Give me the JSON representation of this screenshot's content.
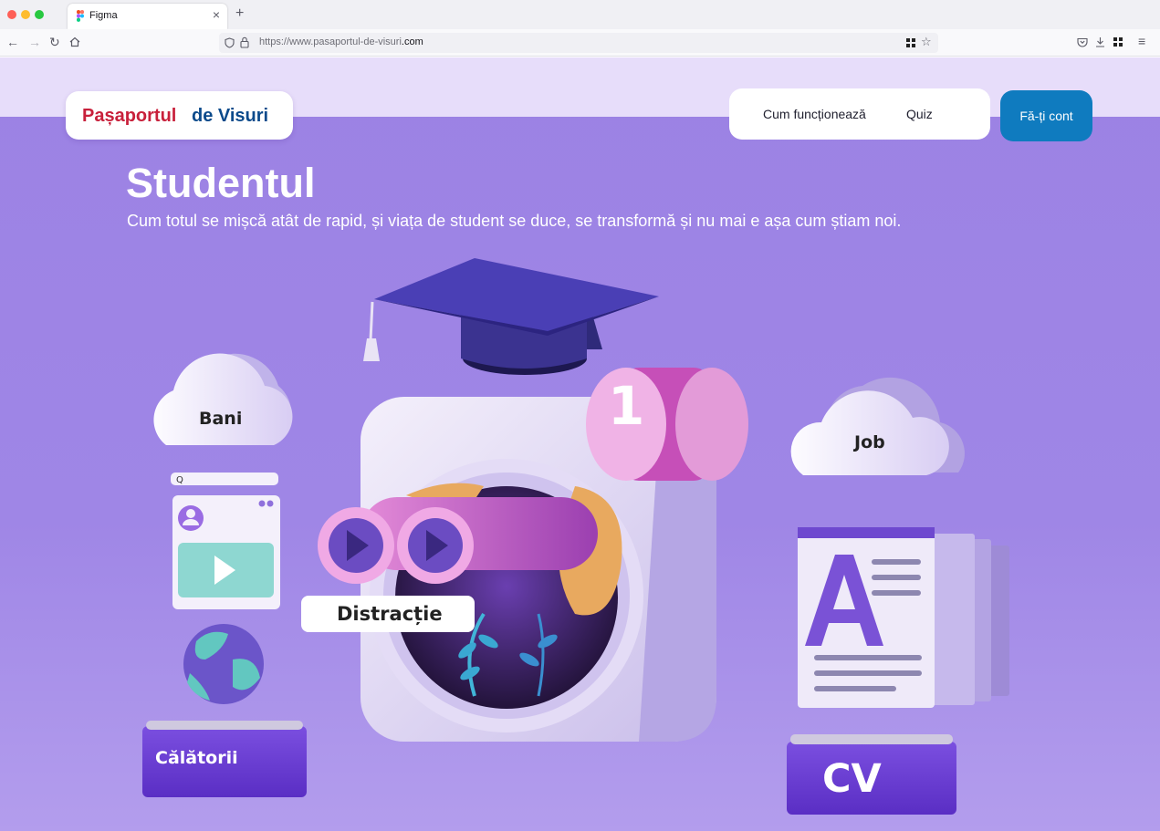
{
  "browser": {
    "tab_title": "Figma",
    "url_prefix": "https://www.pasaportul-de-visuri",
    "url_domain": ".com"
  },
  "site": {
    "logo_part1": "Pașaportul",
    "logo_part2": "de Visuri",
    "nav": [
      "Cum funcționează",
      "Quiz"
    ],
    "cta": "Fă-ți cont"
  },
  "hero": {
    "title": "Studentul",
    "subtitle": "Cum totul se mișcă atât de rapid, și viața de student se duce, se transformă și nu mai e așa cum știam noi."
  },
  "topics": {
    "money": "Bani",
    "job": "Job",
    "fun": "Distracție",
    "travel": "Călătorii",
    "cv": "CV",
    "badge_number": "1"
  },
  "colors": {
    "brand_red": "#c8203b",
    "brand_blue": "#0b4a8b",
    "cta_blue": "#0f7bbf",
    "hero_bg": "#9c82e4"
  }
}
